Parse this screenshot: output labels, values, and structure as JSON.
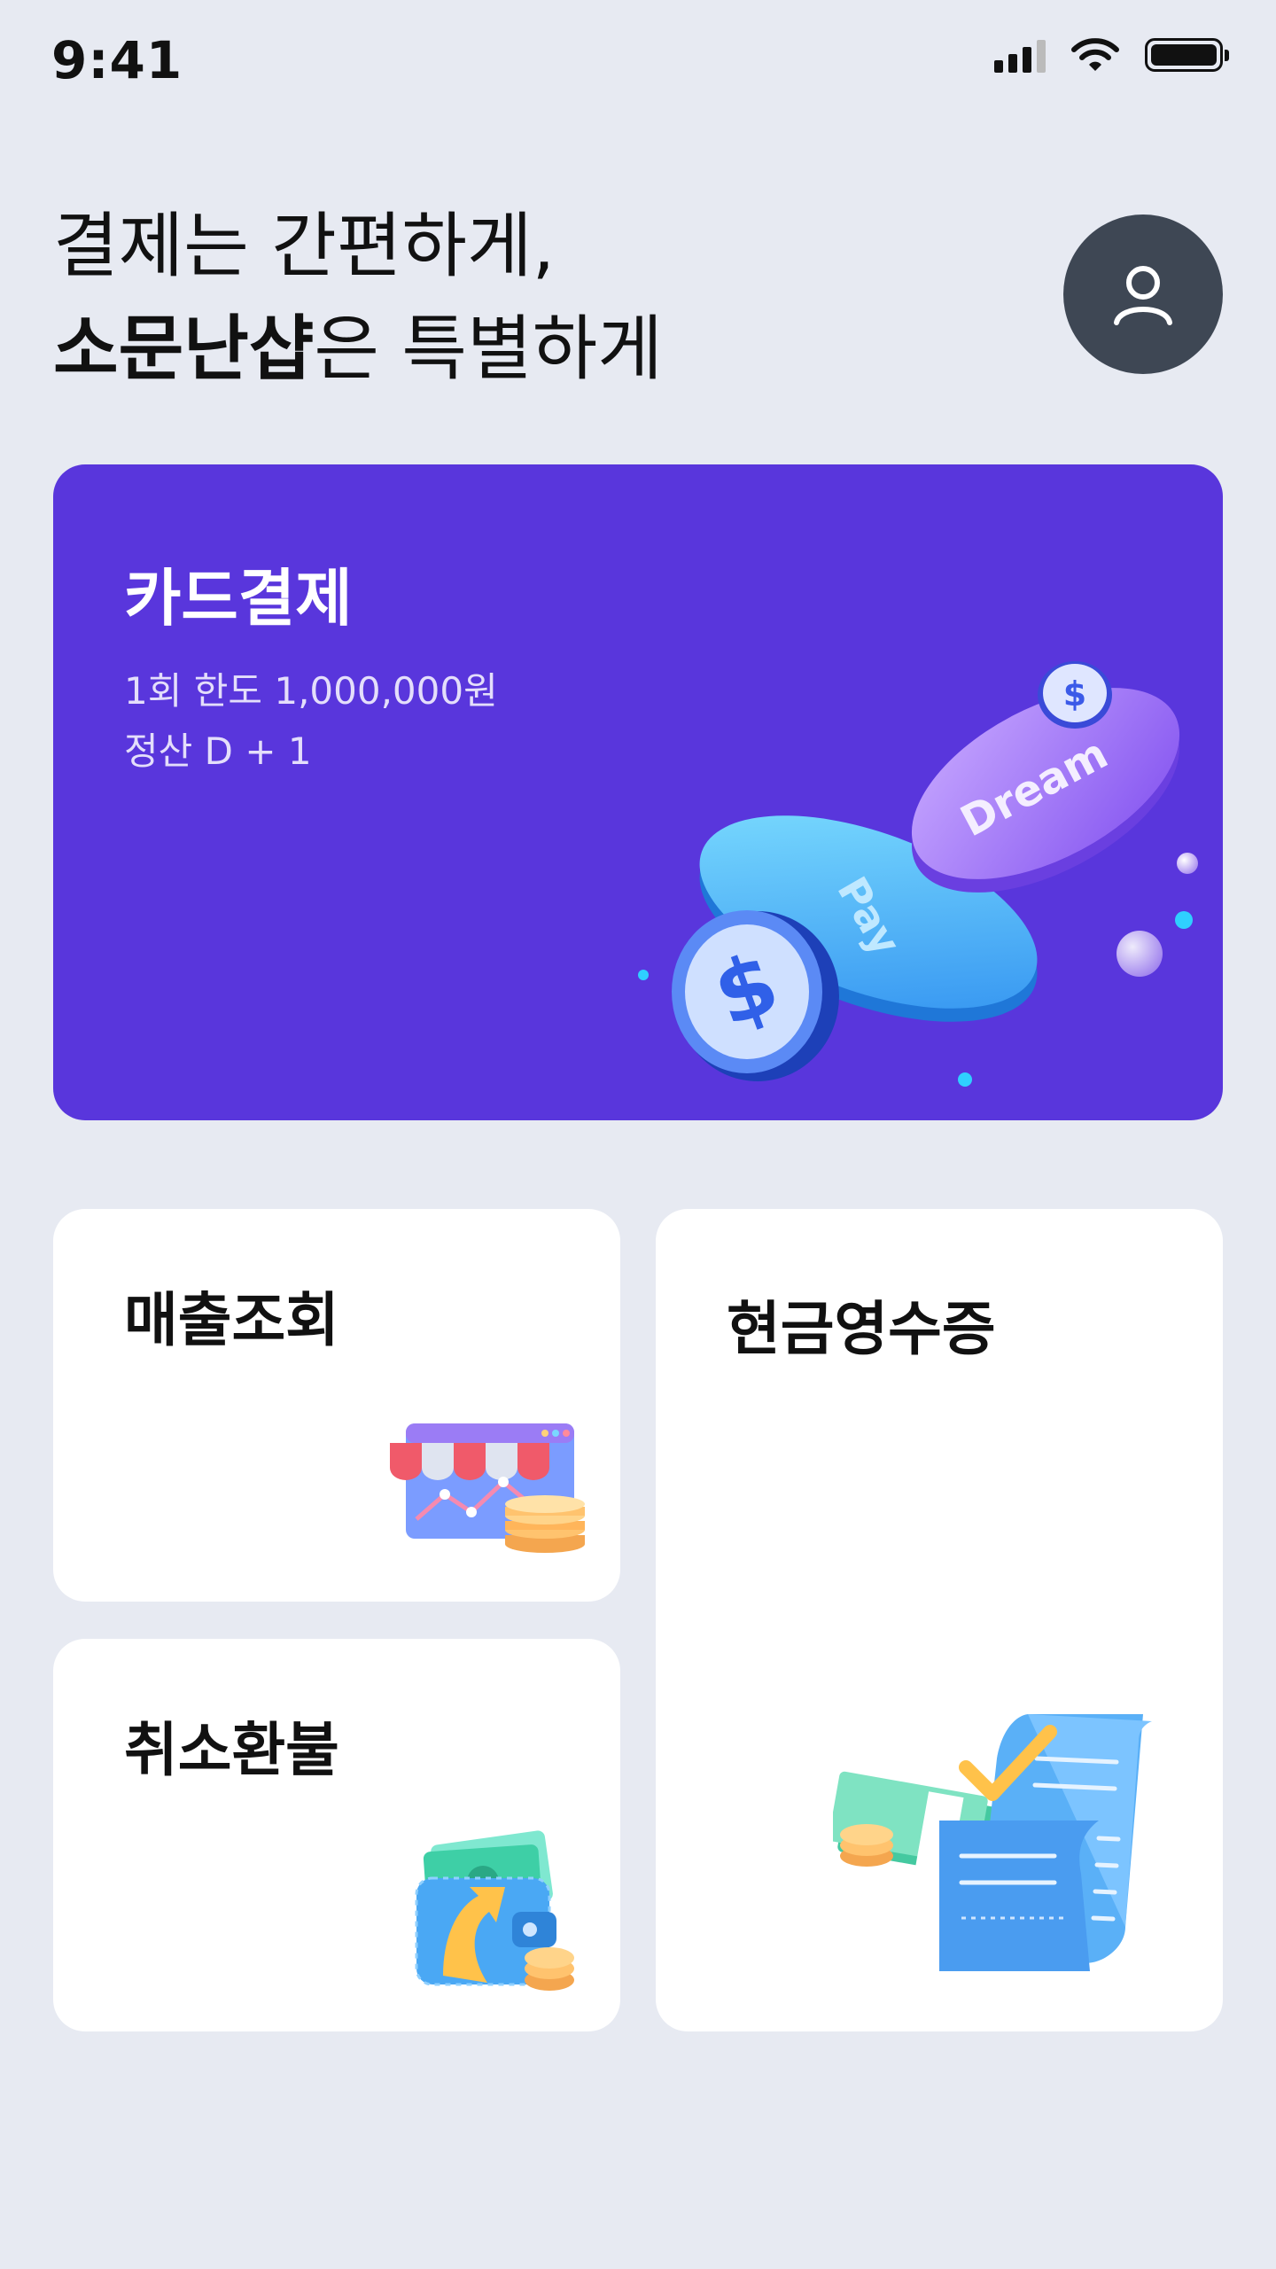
{
  "status": {
    "time": "9:41"
  },
  "greeting": {
    "line1": "결제는 간편하게,",
    "line2_bold": "소문난샵",
    "line2_rest": "은 특별하게"
  },
  "payment": {
    "title": "카드결제",
    "limit": "1회 한도 1,000,000원",
    "settlement": "정산 D + 1",
    "coin_texts": [
      "Dream",
      "Pay"
    ]
  },
  "sales": {
    "title": "매출조회"
  },
  "refund": {
    "title": "취소환불"
  },
  "receipt": {
    "title": "현금영수증"
  },
  "colors": {
    "background": "#e7eaf2",
    "payment_card": "#5936dc",
    "avatar": "#3e4754",
    "card": "#ffffff"
  }
}
